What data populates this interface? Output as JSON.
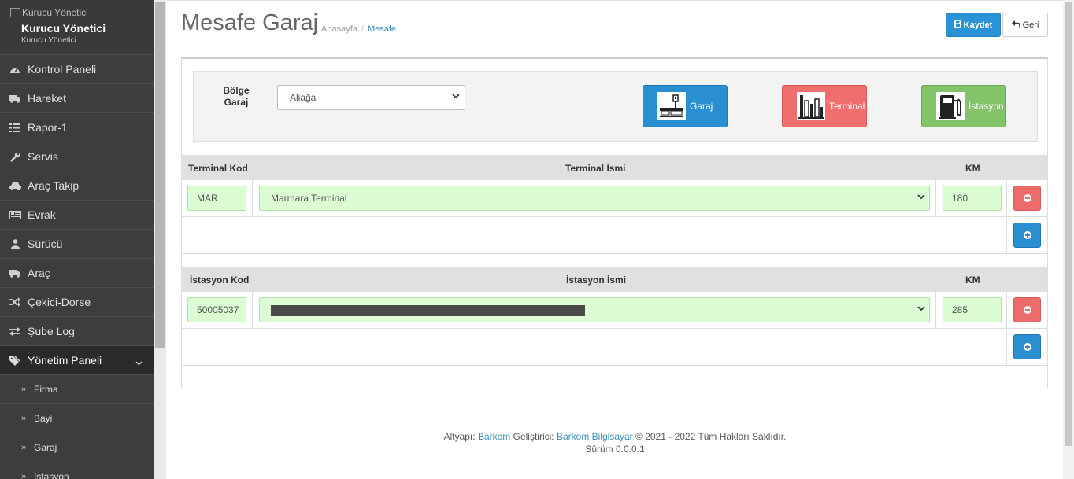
{
  "sidebar": {
    "logo_alt": "Kurucu Yönetici",
    "user_name": "Kurucu Yönetici",
    "user_role": "Kurucu Yönetici",
    "items": [
      {
        "label": "Kontrol Paneli",
        "icon": "dashboard-icon"
      },
      {
        "label": "Hareket",
        "icon": "truck-icon"
      },
      {
        "label": "Rapor-1",
        "icon": "list-icon"
      },
      {
        "label": "Servis",
        "icon": "wrench-icon"
      },
      {
        "label": "Araç Takip",
        "icon": "car-icon"
      },
      {
        "label": "Evrak",
        "icon": "newspaper-icon"
      },
      {
        "label": "Sürücü",
        "icon": "user-icon"
      },
      {
        "label": "Araç",
        "icon": "truck-icon"
      },
      {
        "label": "Çekici-Dorse",
        "icon": "random-icon"
      },
      {
        "label": "Şube Log",
        "icon": "exchange-icon"
      },
      {
        "label": "Yönetim Paneli",
        "icon": "tags-icon"
      }
    ],
    "sub_items": [
      {
        "label": "Firma"
      },
      {
        "label": "Bayi"
      },
      {
        "label": "Garaj"
      },
      {
        "label": "İstasyon"
      }
    ]
  },
  "header": {
    "title": "Mesafe Garaj",
    "breadcrumb_home": "Anasayfa",
    "breadcrumb_sep": "/",
    "breadcrumb_current": "Mesafe",
    "save_label": "Kaydet",
    "back_label": "Geri"
  },
  "filter": {
    "label": "Bölge Garaj",
    "selected": "Aliağa",
    "garaj_label": "Garaj",
    "terminal_label": "Terminal",
    "istasyon_label": "İstasyon"
  },
  "terminal_table": {
    "col_kod": "Terminal Kod",
    "col_isim": "Terminal İsmi",
    "col_km": "KM",
    "rows": [
      {
        "kod": "MAR",
        "isim": "Marmara Terminal",
        "km": "180"
      }
    ]
  },
  "istasyon_table": {
    "col_kod": "İstasyon Kod",
    "col_isim": "İstasyon İsmi",
    "col_km": "KM",
    "rows": [
      {
        "kod": "50005037",
        "isim": "",
        "km": "285"
      }
    ]
  },
  "footer": {
    "altyapi_label": "Altyapı:",
    "altyapi_link": "Barkom",
    "gelistirici_label": "Geliştirici:",
    "gelistirici_link": "Barkom Bilgisayar",
    "copyright": "© 2021 - 2022 Tüm Hakları Saklıdır.",
    "version": "Sürüm 0.0.0.1"
  },
  "colors": {
    "primary": "#2a8fd0",
    "danger": "#f06e6e",
    "success": "#83c46a",
    "sidebar": "#3d3d3d",
    "input_green": "#dcfdd4"
  }
}
